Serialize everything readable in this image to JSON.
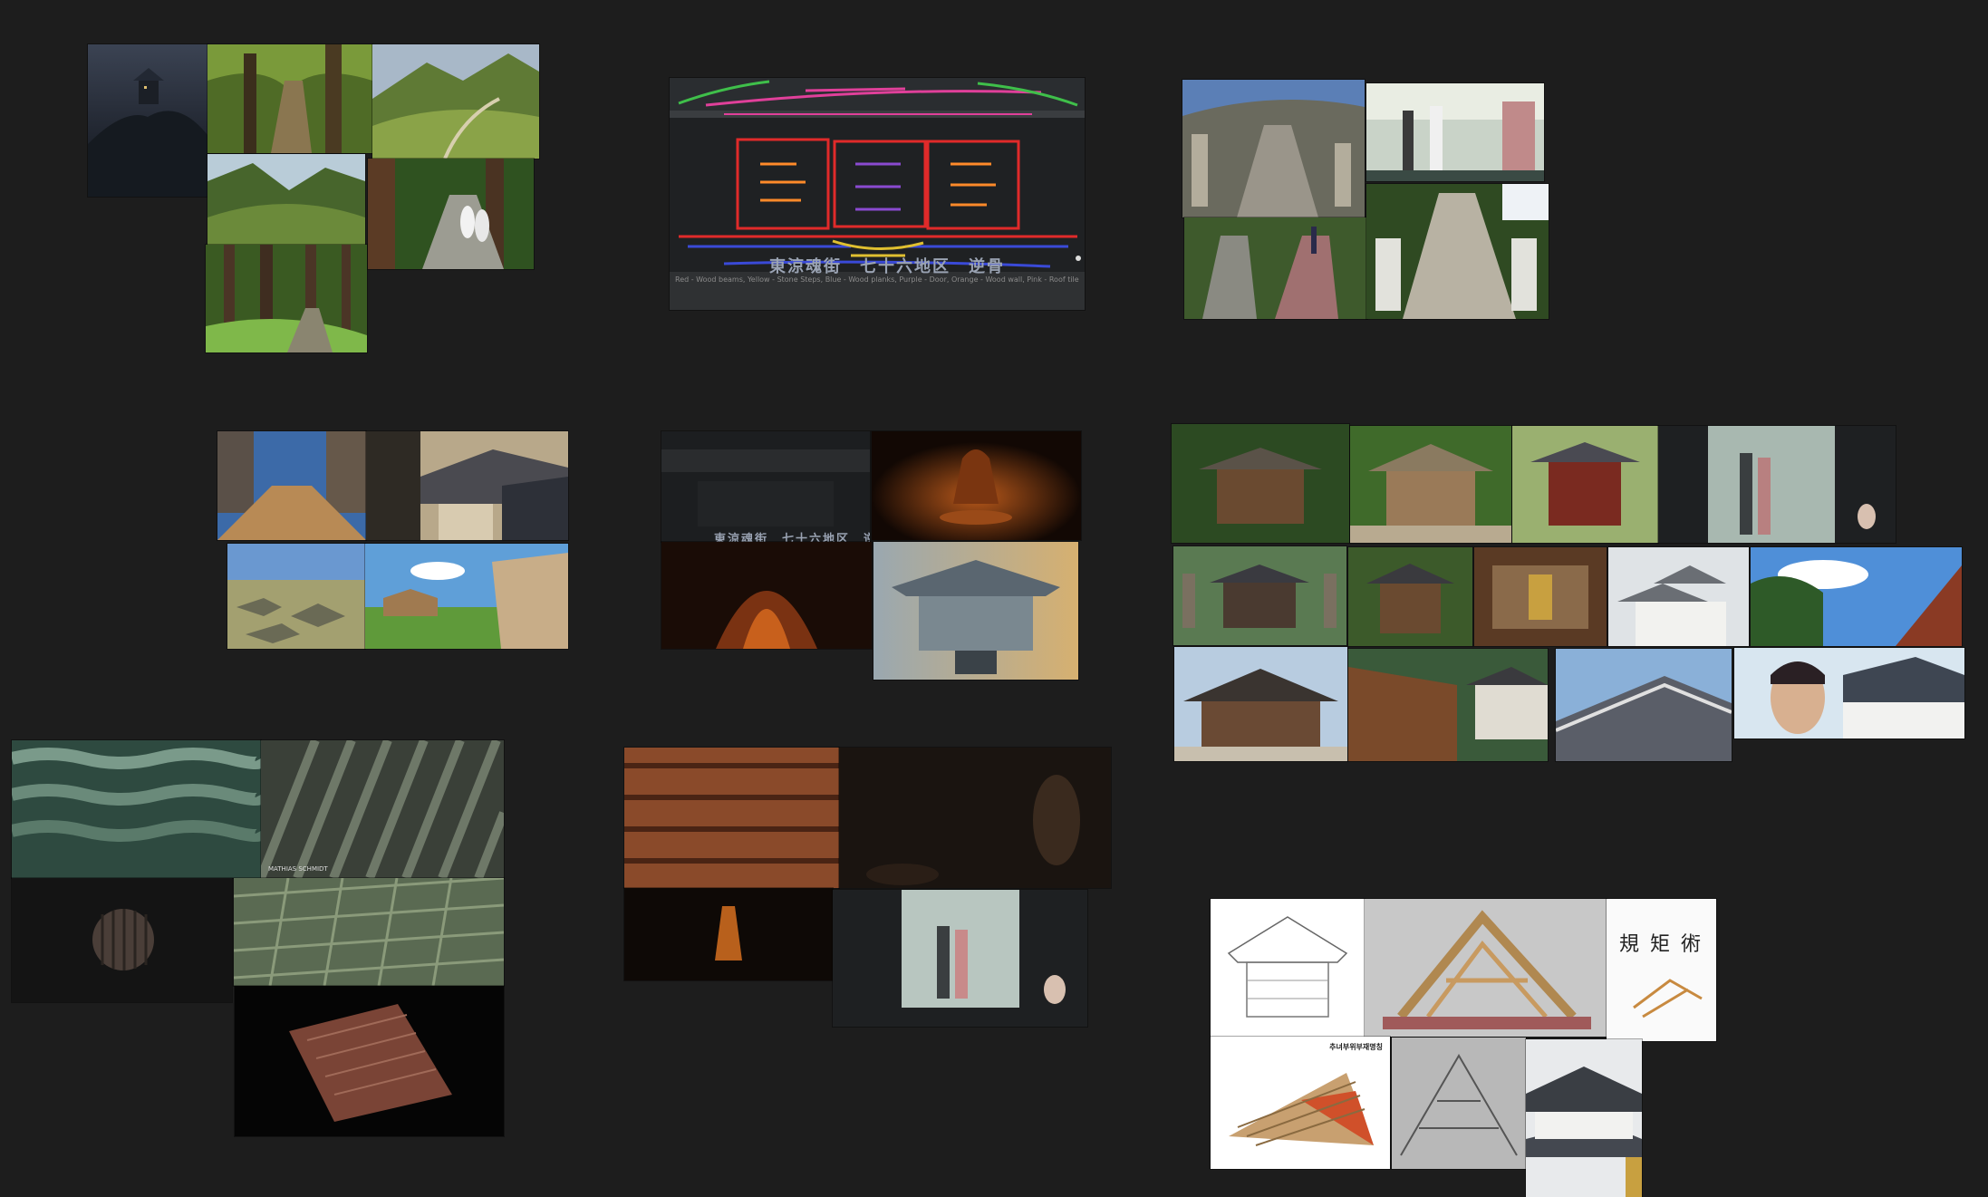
{
  "board": {
    "background": "#1d1d1d"
  },
  "groups": {
    "stone_palette": {
      "caption": "Red - Wood beams, Yellow - Stone Steps, Blue - Wood planks, Purple - Door, Orange - Wood wall, Pink - Roof tiles, Green - Roof supports",
      "sign_text": "東涼魂街　七十六地区　逆骨"
    },
    "shrine_dark": {
      "sign_text": "東涼魂街　七十六地区　逆骨"
    },
    "roof_tiles": {
      "watermark": "MATHIAS SCHMIDT"
    },
    "carpentry": {
      "book_title": "規矩術",
      "diagram_title": "추녀부위부재명칭"
    }
  }
}
